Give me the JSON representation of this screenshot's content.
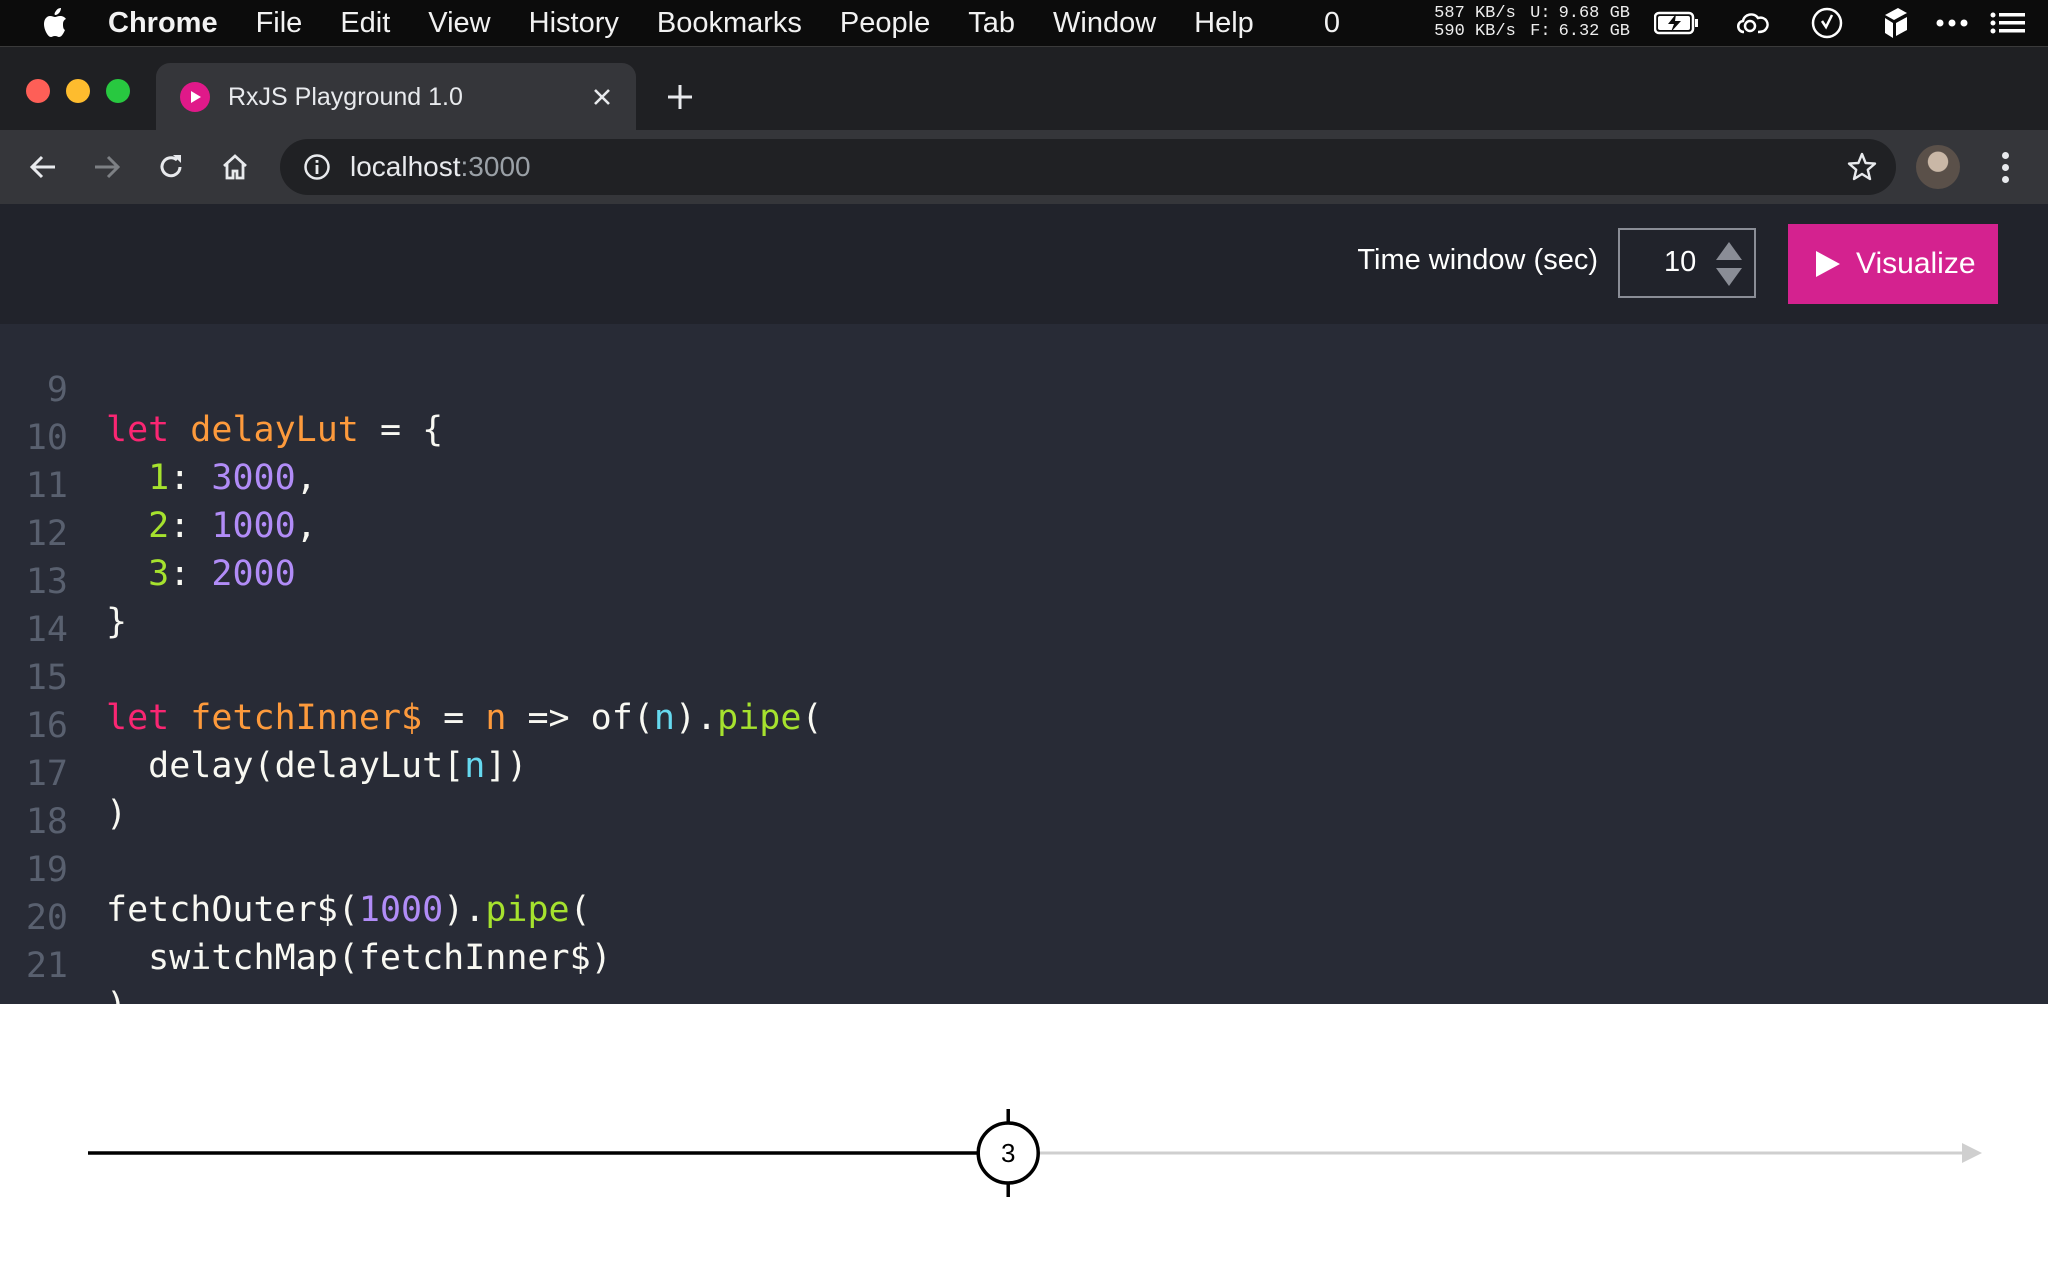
{
  "menubar": {
    "items": [
      "Chrome",
      "File",
      "Edit",
      "View",
      "History",
      "Bookmarks",
      "People",
      "Tab",
      "Window",
      "Help"
    ],
    "counter": "0",
    "net_up": "587 KB/s",
    "net_down": "590 KB/s",
    "mem_u_label": "U:",
    "mem_u": "9.68 GB",
    "mem_f_label": "F:",
    "mem_f": "6.32 GB"
  },
  "browser": {
    "tab_title": "RxJS Playground 1.0",
    "url_host": "localhost",
    "url_port": ":3000"
  },
  "app": {
    "time_window_label": "Time window (sec)",
    "time_window_value": "10",
    "visualize_label": "Visualize"
  },
  "editor": {
    "line_numbers": [
      "9",
      "10",
      "11",
      "12",
      "13",
      "14",
      "15",
      "16",
      "17",
      "18",
      "19",
      "20",
      "21"
    ],
    "lines": [
      "let delayLut = {",
      "  1: 3000,",
      "  2: 1000,",
      "  3: 2000",
      "}",
      "",
      "let fetchInner$ = n => of(n).pipe(",
      "  delay(delayLut[n])",
      ")",
      "",
      "fetchOuter$(1000).pipe(",
      "  switchMap(fetchInner$)",
      ")"
    ]
  },
  "marble": {
    "value_label": "3",
    "position_fraction": 0.49,
    "completed": true
  }
}
